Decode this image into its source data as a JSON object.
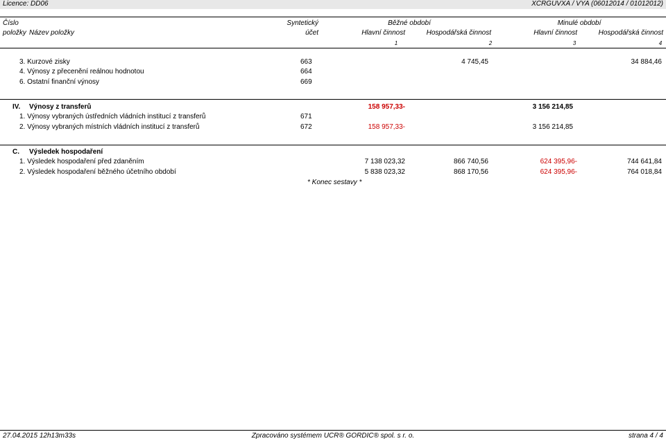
{
  "header": {
    "licence": "Licence: DD06",
    "report_id": "XCRGUVXA / VYA  (06012014 / 01012012)"
  },
  "columns": {
    "cislo": "Číslo",
    "polozky": "položky",
    "nazev": "Název položky",
    "synteticky": "Syntetický",
    "ucet": "účet",
    "bezne_obdobi": "Běžné období",
    "minule_obdobi": "Minulé období",
    "hlavni_1": "Hlavní činnost",
    "hosp_1": "Hospodářská činnost",
    "hlavni_2": "Hlavní činnost",
    "hosp_2": "Hospodářská činnost",
    "num_1": "1",
    "num_2": "2",
    "num_3": "3",
    "num_4": "4"
  },
  "rows_a": [
    {
      "label": "3.  Kurzové zisky",
      "ucet": "663",
      "c2": "4 745,45",
      "c4": "34 884,46"
    },
    {
      "label": "4.  Výnosy z přecenění reálnou hodnotou",
      "ucet": "664"
    },
    {
      "label": "6.  Ostatní finanční výnosy",
      "ucet": "669"
    }
  ],
  "section_iv": {
    "num": "IV.",
    "title": "Výnosy z transferů",
    "c1": "158 957,33-",
    "c3": "3 156 214,85",
    "rows": [
      {
        "label": "1.  Výnosy vybraných ústředních vládních institucí z transferů",
        "ucet": "671"
      },
      {
        "label": "2.  Výnosy vybraných místních vládních institucí z transferů",
        "ucet": "672",
        "c1": "158 957,33-",
        "c3": "3 156 214,85"
      }
    ]
  },
  "section_c": {
    "num": "C.",
    "title": "Výsledek hospodaření",
    "rows": [
      {
        "label": "1.  Výsledek hospodaření před zdaněním",
        "c1": "7 138 023,32",
        "c2": "866 740,56",
        "c3": "624 395,96-",
        "c4": "744 641,84"
      },
      {
        "label": "2.  Výsledek hospodaření běžného účetního období",
        "c1": "5 838 023,32",
        "c2": "868 170,56",
        "c3": "624 395,96-",
        "c4": "764 018,84"
      }
    ]
  },
  "end_text": "* Konec sestavy *",
  "footer": {
    "date": "27.04.2015 12h13m33s",
    "system": "Zpracováno systémem  UCR® GORDIC® spol. s  r. o.",
    "page": "strana 4 / 4"
  }
}
